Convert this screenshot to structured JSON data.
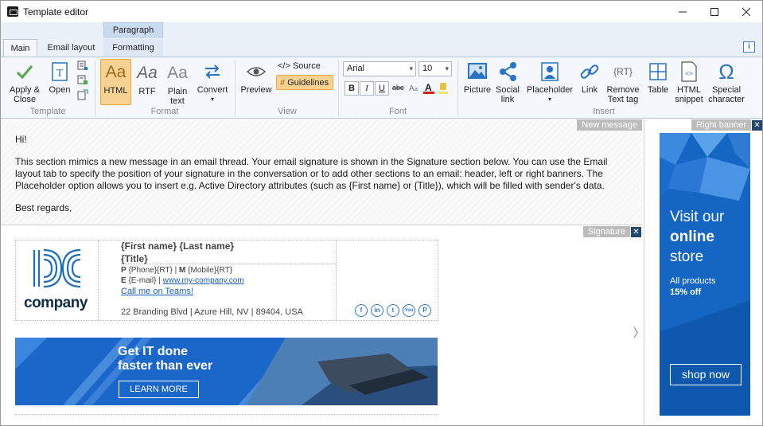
{
  "window": {
    "title": "Template editor"
  },
  "tabs": {
    "context_header": "Paragraph",
    "items": [
      "Main",
      "Email layout",
      "Formatting"
    ],
    "info": "i"
  },
  "ribbon": {
    "template": {
      "apply": "Apply &",
      "apply2": "Close",
      "open": "Open",
      "group": "Template"
    },
    "format": {
      "html": "HTML",
      "rtf": "RTF",
      "plain": "Plain",
      "plain2": "text",
      "convert": "Convert",
      "group": "Format",
      "html_glyph": "Aa",
      "rtf_glyph": "Aa",
      "plain_glyph": "Aa"
    },
    "view": {
      "preview": "Preview",
      "source": "</> Source",
      "guidelines": "Guidelines",
      "group": "View"
    },
    "font": {
      "family": "Arial",
      "size": "10",
      "bold": "B",
      "italic": "I",
      "underline": "U",
      "strike": "abc",
      "group": "Font"
    },
    "insert": {
      "picture": "Picture",
      "social": "Social",
      "social2": "link",
      "placeholder": "Placeholder",
      "link": "Link",
      "remove": "Remove",
      "remove2": "Text tag",
      "table": "Table",
      "snippet": "HTML",
      "snippet2": "snippet",
      "special": "Special",
      "special2": "character",
      "group": "Insert",
      "rt_glyph": "{RT}",
      "omega": "Ω"
    }
  },
  "editor": {
    "new_message_tag": "New message",
    "signature_tag": "Signature",
    "right_banner_tag": "Right banner",
    "message": {
      "greeting": "Hi!",
      "body": "This section mimics a new message in an email thread. Your email signature is shown in the Signature section below. You can use the Email layout tab to specify the position of your signature in the conversation or to add other sections to an email: header, left or right banners. The Placeholder option allows you to insert e.g. Active Directory attributes (such as {First name} or {Title}), which will be filled with sender's data.",
      "closing": "Best regards,"
    },
    "signature": {
      "logo_text": "company",
      "name": "{First name} {Last name}",
      "title": "{Title}",
      "phone_label": "P",
      "phone": "{Phone}{RT} | ",
      "mobile_label": "M",
      "mobile": "{Mobile}{RT}",
      "email_label": "E",
      "email": "{E-mail} | ",
      "website": "www.my-company.com",
      "teams": "Call me on Teams!",
      "address": "22 Branding Blvd | Azure Hill, NV | 89404, USA",
      "socials": [
        "f",
        "in",
        "t",
        "You",
        "P"
      ]
    },
    "banner": {
      "line1": "Get IT done",
      "line2": "faster than ever",
      "button": "LEARN MORE"
    }
  },
  "right_banner": {
    "line1": "Visit our",
    "line2": "online",
    "line3": "store",
    "small1": "All products",
    "small2": "15% off",
    "button": "shop now",
    "chevron": "〉"
  },
  "colors": {
    "accent": "#1566c2",
    "ribbon_bg": "#f4f7fb",
    "active": "#f8d292"
  }
}
